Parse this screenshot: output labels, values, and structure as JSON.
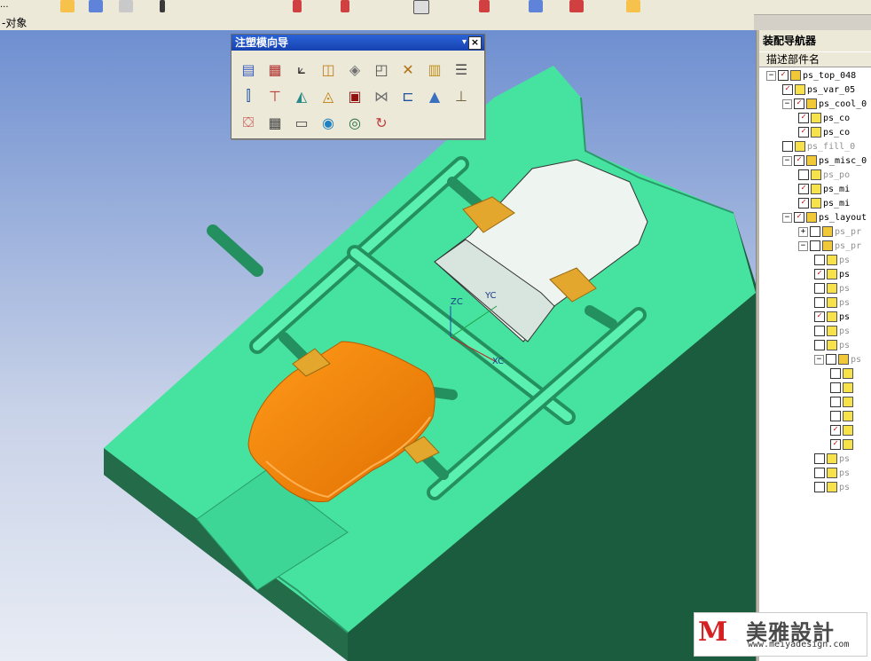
{
  "toolbar": {
    "left_label": "...",
    "icons": [
      "cursor-icon",
      "part-icon",
      "view-icon",
      "arrow-icon",
      "layer-icon",
      "edit-icon",
      "curve-icon",
      "surface-icon",
      "feature-icon",
      "shade-icon",
      "render-icon"
    ]
  },
  "statusline": {
    "text": "-对象"
  },
  "wizard": {
    "title": "注塑模向导",
    "close": "×",
    "dropdown": "▾",
    "buttons": [
      {
        "icon": "project-init-icon",
        "glyph": "▤",
        "color": "#3a5dbf"
      },
      {
        "icon": "family-mold-icon",
        "glyph": "▦",
        "color": "#b03030"
      },
      {
        "icon": "mold-csys-icon",
        "glyph": "⟀",
        "color": "#2a2a2a"
      },
      {
        "icon": "shrinkage-icon",
        "glyph": "◫",
        "color": "#c08020"
      },
      {
        "icon": "workpiece-icon",
        "glyph": "◈",
        "color": "#707070"
      },
      {
        "icon": "layout-icon",
        "glyph": "◰",
        "color": "#505050"
      },
      {
        "icon": "tools-icon",
        "glyph": "✕",
        "color": "#b07010"
      },
      {
        "icon": "parting-icon",
        "glyph": "▥",
        "color": "#c09020"
      },
      {
        "icon": "mold-base-icon",
        "glyph": "☰",
        "color": "#505050"
      },
      {
        "icon": "standard-parts-icon",
        "glyph": "⫿",
        "color": "#2050a0"
      },
      {
        "icon": "ejector-pin-icon",
        "glyph": "⊤",
        "color": "#b03030"
      },
      {
        "icon": "slider-icon",
        "glyph": "◭",
        "color": "#2a8a8a"
      },
      {
        "icon": "subinsert-icon",
        "glyph": "◬",
        "color": "#c08010"
      },
      {
        "icon": "gate-icon",
        "glyph": "▣",
        "color": "#901010"
      },
      {
        "icon": "runner-icon",
        "glyph": "⋈",
        "color": "#707070"
      },
      {
        "icon": "cooling-icon",
        "glyph": "⊏",
        "color": "#2050a0"
      },
      {
        "icon": "electrode-icon",
        "glyph": "▲",
        "color": "#3a70c0"
      },
      {
        "icon": "trim-icon",
        "glyph": "⊥",
        "color": "#706040"
      },
      {
        "icon": "pocket-icon",
        "glyph": "⛋",
        "color": "#c04040"
      },
      {
        "icon": "bom-icon",
        "glyph": "▦",
        "color": "#404040"
      },
      {
        "icon": "drawing-icon",
        "glyph": "▭",
        "color": "#505050"
      },
      {
        "icon": "hole-table-icon",
        "glyph": "◉",
        "color": "#2080c0"
      },
      {
        "icon": "view-manager-icon",
        "glyph": "◎",
        "color": "#207040"
      },
      {
        "icon": "unused-parts-icon",
        "glyph": "↻",
        "color": "#c04040"
      }
    ]
  },
  "assembly_navigator": {
    "title": "装配导航器",
    "column_header": "描述部件名",
    "items": [
      {
        "expander": "−",
        "checked": true,
        "type": "asm",
        "label": "ps_top_048",
        "grey": false
      },
      {
        "expander": "",
        "checked": true,
        "type": "part",
        "label": "ps_var_05",
        "grey": false
      },
      {
        "expander": "−",
        "checked": true,
        "type": "asm",
        "label": "ps_cool_0",
        "grey": false
      },
      {
        "expander": "",
        "checked": true,
        "type": "part",
        "label": "ps_co",
        "grey": false
      },
      {
        "expander": "",
        "checked": true,
        "type": "part",
        "label": "ps_co",
        "grey": false
      },
      {
        "expander": "",
        "checked": false,
        "type": "part",
        "label": "ps_fill_0",
        "grey": true
      },
      {
        "expander": "−",
        "checked": true,
        "type": "asm",
        "label": "ps_misc_0",
        "grey": false
      },
      {
        "expander": "",
        "checked": false,
        "type": "part",
        "label": "ps_po",
        "grey": true
      },
      {
        "expander": "",
        "checked": true,
        "type": "part",
        "label": "ps_mi",
        "grey": false
      },
      {
        "expander": "",
        "checked": true,
        "type": "part",
        "label": "ps_mi",
        "grey": false
      },
      {
        "expander": "−",
        "checked": true,
        "type": "asm",
        "label": "ps_layout",
        "grey": false
      },
      {
        "expander": "+",
        "checked": false,
        "type": "asm",
        "label": "ps_pr",
        "grey": true
      },
      {
        "expander": "−",
        "checked": false,
        "type": "asm",
        "label": "ps_pr",
        "grey": true
      },
      {
        "expander": "",
        "checked": false,
        "type": "part",
        "label": "ps",
        "grey": true
      },
      {
        "expander": "",
        "checked": true,
        "type": "part",
        "label": "ps",
        "grey": false
      },
      {
        "expander": "",
        "checked": false,
        "type": "part",
        "label": "ps",
        "grey": true
      },
      {
        "expander": "",
        "checked": false,
        "type": "part",
        "label": "ps",
        "grey": true
      },
      {
        "expander": "",
        "checked": true,
        "type": "part",
        "label": "ps",
        "grey": false
      },
      {
        "expander": "",
        "checked": false,
        "type": "part",
        "label": "ps",
        "grey": true
      },
      {
        "expander": "",
        "checked": false,
        "type": "part",
        "label": "ps",
        "grey": true
      },
      {
        "expander": "−",
        "checked": false,
        "type": "asm",
        "label": "ps",
        "grey": true
      },
      {
        "expander": "",
        "checked": false,
        "type": "part",
        "label": "",
        "grey": false
      },
      {
        "expander": "",
        "checked": false,
        "type": "part",
        "label": "",
        "grey": false
      },
      {
        "expander": "",
        "checked": false,
        "type": "part",
        "label": "",
        "grey": false
      },
      {
        "expander": "",
        "checked": false,
        "type": "part",
        "label": "",
        "grey": false
      },
      {
        "expander": "",
        "checked": true,
        "type": "part",
        "label": "",
        "grey": false
      },
      {
        "expander": "",
        "checked": true,
        "type": "part",
        "label": "",
        "grey": false
      },
      {
        "expander": "",
        "checked": false,
        "type": "part",
        "label": "ps",
        "grey": true
      },
      {
        "expander": "",
        "checked": false,
        "type": "part",
        "label": "ps",
        "grey": true
      },
      {
        "expander": "",
        "checked": false,
        "type": "part",
        "label": "ps",
        "grey": true
      }
    ]
  },
  "viewport": {
    "csys": {
      "zc": "ZC",
      "yc": "YC",
      "xc": "XC"
    },
    "colors": {
      "plate": "#46e3a0",
      "plate_dark": "#268c5c",
      "plate_side": "#1c5c3e",
      "part_orange": "#fb8a08",
      "part_light": "#eef4f0",
      "gate": "#e3a72e",
      "bg_top": "#6e8fd0",
      "bg_bottom": "#e8ecf4"
    }
  },
  "watermark": {
    "logo": "M",
    "text": "美雅設計",
    "url": "www.meiyadesign.com"
  }
}
